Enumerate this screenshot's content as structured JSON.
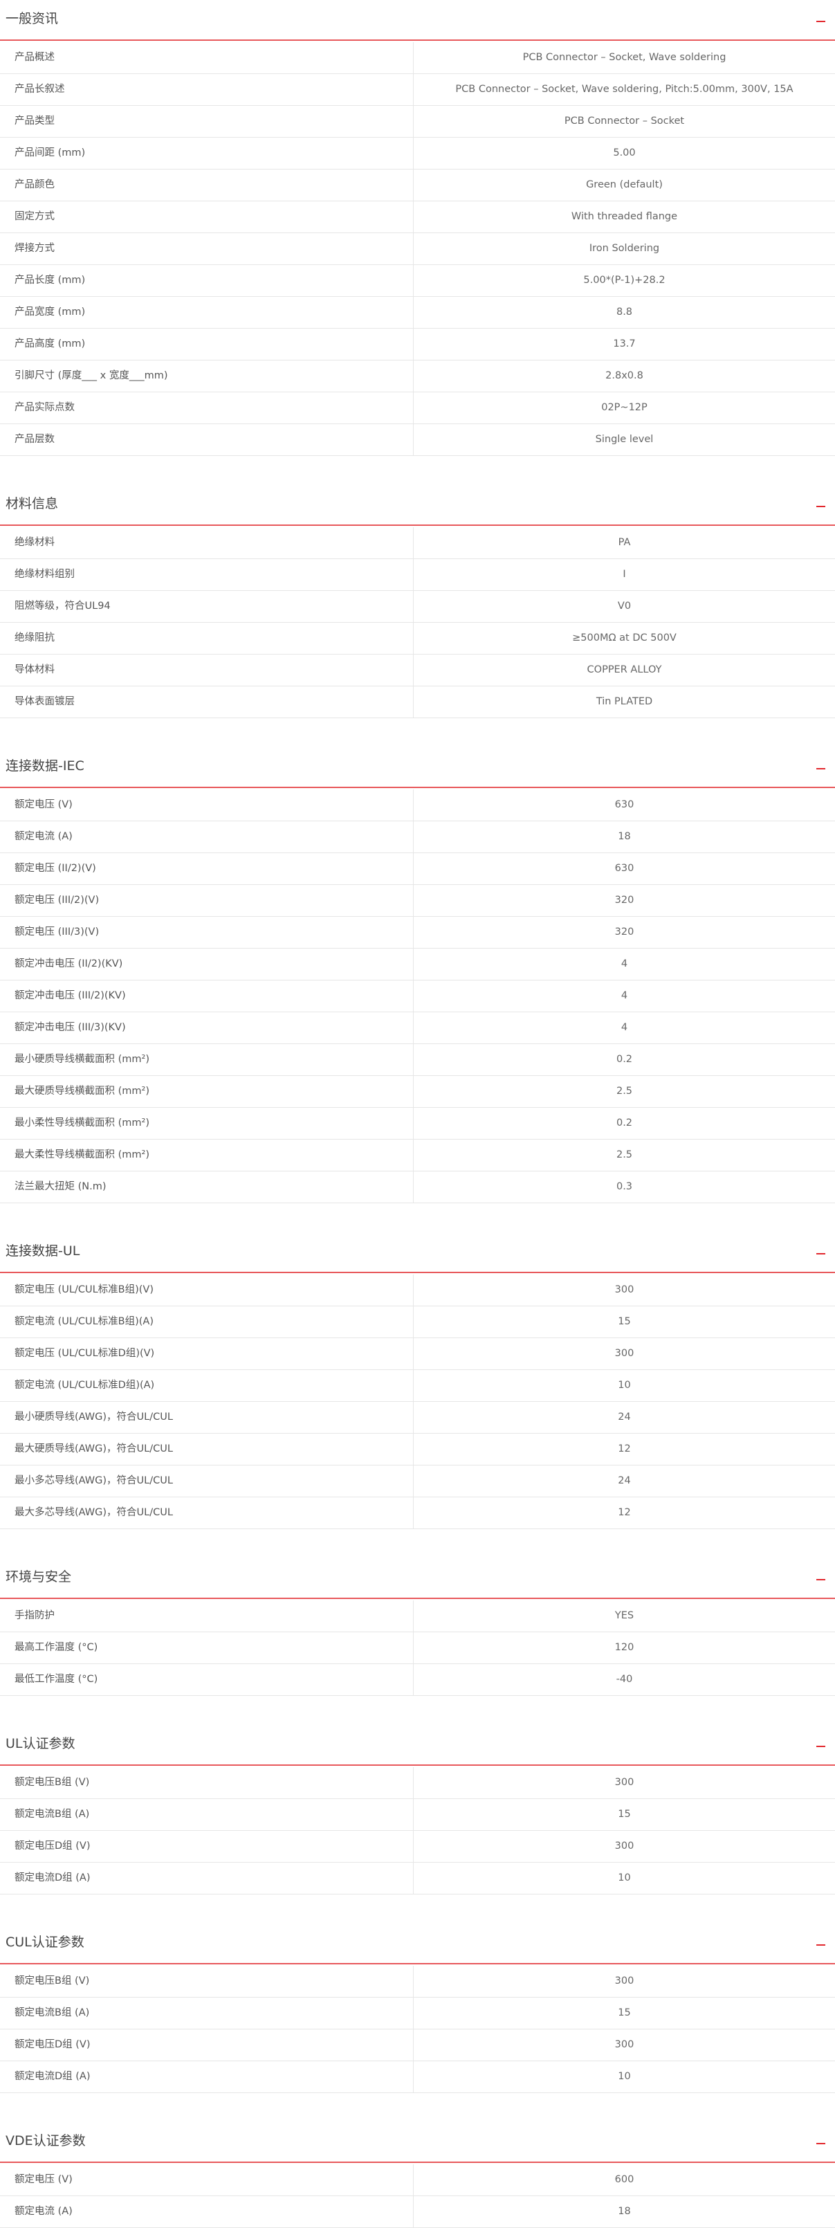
{
  "sections": [
    {
      "title": "一般资讯",
      "rows": [
        {
          "label": "产品概述",
          "value": "PCB Connector – Socket, Wave soldering"
        },
        {
          "label": "产品长叙述",
          "value": "PCB Connector – Socket, Wave soldering, Pitch:5.00mm, 300V, 15A"
        },
        {
          "label": "产品类型",
          "value": "PCB Connector – Socket"
        },
        {
          "label": "产品间距 (mm)",
          "value": "5.00"
        },
        {
          "label": "产品颜色",
          "value": "Green (default)"
        },
        {
          "label": "固定方式",
          "value": "With threaded flange"
        },
        {
          "label": "焊接方式",
          "value": "Iron Soldering"
        },
        {
          "label": "产品长度 (mm)",
          "value": "5.00*(P-1)+28.2"
        },
        {
          "label": "产品宽度 (mm)",
          "value": "8.8"
        },
        {
          "label": "产品高度 (mm)",
          "value": "13.7"
        },
        {
          "label": "引脚尺寸 (厚度___ x 宽度___mm)",
          "value": "2.8x0.8"
        },
        {
          "label": "产品实际点数",
          "value": "02P~12P"
        },
        {
          "label": "产品层数",
          "value": "Single level"
        }
      ]
    },
    {
      "title": "材料信息",
      "rows": [
        {
          "label": "绝缘材料",
          "value": "PA"
        },
        {
          "label": "绝缘材料组别",
          "value": "I"
        },
        {
          "label": "阻燃等级，符合UL94",
          "value": "V0"
        },
        {
          "label": "绝缘阻抗",
          "value": "≥500MΩ at DC 500V"
        },
        {
          "label": "导体材料",
          "value": "COPPER ALLOY"
        },
        {
          "label": "导体表面镀层",
          "value": "Tin PLATED"
        }
      ]
    },
    {
      "title": "连接数据-IEC",
      "rows": [
        {
          "label": "额定电压 (V)",
          "value": "630"
        },
        {
          "label": "额定电流 (A)",
          "value": "18"
        },
        {
          "label": "额定电压 (II/2)(V)",
          "value": "630"
        },
        {
          "label": "额定电压 (III/2)(V)",
          "value": "320"
        },
        {
          "label": "额定电压 (III/3)(V)",
          "value": "320"
        },
        {
          "label": "额定冲击电压 (II/2)(KV)",
          "value": "4"
        },
        {
          "label": "额定冲击电压 (III/2)(KV)",
          "value": "4"
        },
        {
          "label": "额定冲击电压 (III/3)(KV)",
          "value": "4"
        },
        {
          "label": "最小硬质导线横截面积 (mm²)",
          "value": "0.2"
        },
        {
          "label": "最大硬质导线横截面积 (mm²)",
          "value": "2.5"
        },
        {
          "label": "最小柔性导线横截面积 (mm²)",
          "value": "0.2"
        },
        {
          "label": "最大柔性导线横截面积 (mm²)",
          "value": "2.5"
        },
        {
          "label": "法兰最大扭矩 (N.m)",
          "value": "0.3"
        }
      ]
    },
    {
      "title": "连接数据-UL",
      "rows": [
        {
          "label": "额定电压 (UL/CUL标准B组)(V)",
          "value": "300"
        },
        {
          "label": "额定电流 (UL/CUL标准B组)(A)",
          "value": "15"
        },
        {
          "label": "额定电压 (UL/CUL标准D组)(V)",
          "value": "300"
        },
        {
          "label": "额定电流 (UL/CUL标准D组)(A)",
          "value": "10"
        },
        {
          "label": "最小硬质导线(AWG)，符合UL/CUL",
          "value": "24"
        },
        {
          "label": "最大硬质导线(AWG)，符合UL/CUL",
          "value": "12"
        },
        {
          "label": "最小多芯导线(AWG)，符合UL/CUL",
          "value": "24"
        },
        {
          "label": "最大多芯导线(AWG)，符合UL/CUL",
          "value": "12"
        }
      ]
    },
    {
      "title": "环境与安全",
      "rows": [
        {
          "label": "手指防护",
          "value": "YES"
        },
        {
          "label": "最高工作温度 (°C)",
          "value": "120"
        },
        {
          "label": "最低工作温度 (°C)",
          "value": "-40"
        }
      ]
    },
    {
      "title": "UL认证参数",
      "rows": [
        {
          "label": "额定电压B组 (V)",
          "value": "300"
        },
        {
          "label": "额定电流B组 (A)",
          "value": "15"
        },
        {
          "label": "额定电压D组 (V)",
          "value": "300"
        },
        {
          "label": "额定电流D组 (A)",
          "value": "10"
        }
      ]
    },
    {
      "title": "CUL认证参数",
      "rows": [
        {
          "label": "额定电压B组 (V)",
          "value": "300"
        },
        {
          "label": "额定电流B组 (A)",
          "value": "15"
        },
        {
          "label": "额定电压D组 (V)",
          "value": "300"
        },
        {
          "label": "额定电流D组 (A)",
          "value": "10"
        }
      ]
    },
    {
      "title": "VDE认证参数",
      "rows": [
        {
          "label": "额定电压 (V)",
          "value": "600"
        },
        {
          "label": "额定电流 (A)",
          "value": "18"
        }
      ]
    }
  ],
  "colors": {
    "accent": "#e2272d",
    "divider": "#e8585b",
    "border": "#e6e6e6"
  },
  "icons": {
    "toggle": "collapse-minus-icon"
  }
}
